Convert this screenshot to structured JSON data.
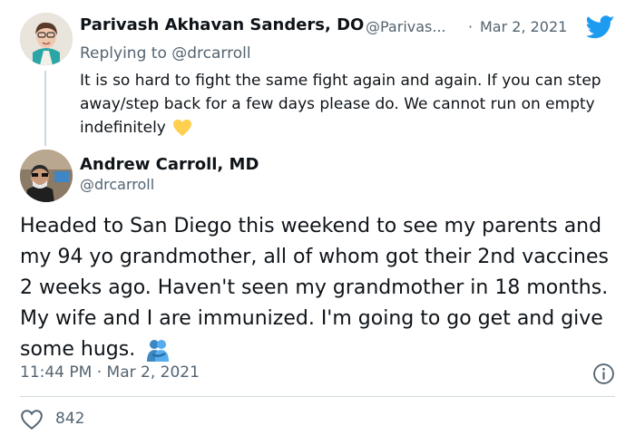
{
  "reply_tweet": {
    "author_name": "Parivash Akhavan Sanders, DO",
    "author_handle": "@Parivas...",
    "separator": "·",
    "date": "Mar 2, 2021",
    "replying_to_prefix": "Replying to ",
    "replying_to_handle": "@drcarroll",
    "text": "It is so hard to fight the same fight again and again. If you can step away/step back for a few days please do. We cannot run on empty indefinitely",
    "emoji": "yellow-heart"
  },
  "main_tweet": {
    "author_name": "Andrew Carroll, MD",
    "author_handle": "@drcarroll",
    "text": "Headed to San Diego this weekend to see my parents and my 94 yo grandmother, all of whom got their 2nd vaccines 2 weeks ago. Haven't seen my grandmother in 18 months. My wife and I are immunized. I'm going to go get and give some hugs.",
    "emoji": "people-hugging",
    "time": "11:44 PM",
    "separator": "·",
    "date": "Mar 2, 2021",
    "like_count": "842"
  },
  "colors": {
    "twitter_blue": "#1d9bf0",
    "text": "#0f1419",
    "muted": "#536471",
    "divider": "#cfd9de",
    "heart_yellow": "#ffd04f"
  }
}
